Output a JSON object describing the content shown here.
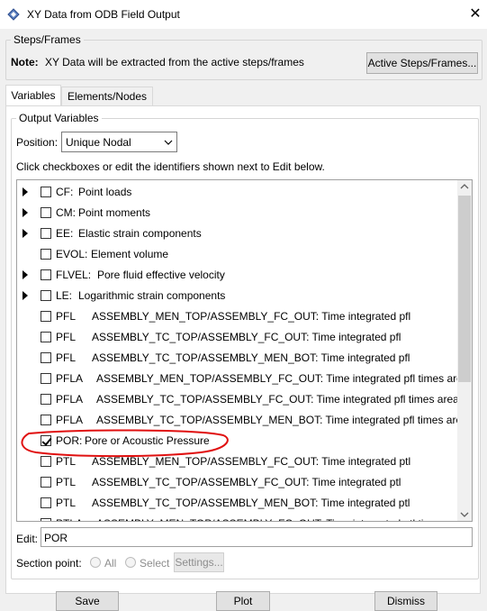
{
  "window": {
    "title": "XY Data from ODB Field Output",
    "close_glyph": "✕"
  },
  "steps": {
    "group_label": "Steps/Frames",
    "note_label": "Note:",
    "note_text": "XY Data will be extracted from the active steps/frames",
    "active_button": "Active Steps/Frames..."
  },
  "tabs": [
    {
      "label": "Variables",
      "active": true
    },
    {
      "label": "Elements/Nodes",
      "active": false
    }
  ],
  "output": {
    "group_label": "Output Variables",
    "position_label": "Position:",
    "position_value": "Unique Nodal",
    "hint": "Click checkboxes or edit the identifiers shown next to Edit below."
  },
  "variables": [
    {
      "code": "CF:",
      "desc": "Point loads",
      "expandable": true,
      "checked": false
    },
    {
      "code": "CM:",
      "desc": "Point moments",
      "expandable": true,
      "checked": false
    },
    {
      "code": "EE:",
      "desc": "Elastic strain components",
      "expandable": true,
      "checked": false
    },
    {
      "code": "EVOL:",
      "desc": "Element volume",
      "expandable": false,
      "checked": false
    },
    {
      "code": "FLVEL:",
      "desc": "Pore fluid effective velocity",
      "expandable": true,
      "checked": false
    },
    {
      "code": "LE:",
      "desc": "Logarithmic strain components",
      "expandable": true,
      "checked": false
    },
    {
      "code": "PFL",
      "desc": "ASSEMBLY_MEN_TOP/ASSEMBLY_FC_OUT: Time integrated pfl",
      "expandable": false,
      "checked": false
    },
    {
      "code": "PFL",
      "desc": "ASSEMBLY_TC_TOP/ASSEMBLY_FC_OUT: Time integrated pfl",
      "expandable": false,
      "checked": false
    },
    {
      "code": "PFL",
      "desc": "ASSEMBLY_TC_TOP/ASSEMBLY_MEN_BOT: Time integrated pfl",
      "expandable": false,
      "checked": false
    },
    {
      "code": "PFLA",
      "desc": "ASSEMBLY_MEN_TOP/ASSEMBLY_FC_OUT: Time integrated pfl times area",
      "expandable": false,
      "checked": false
    },
    {
      "code": "PFLA",
      "desc": "ASSEMBLY_TC_TOP/ASSEMBLY_FC_OUT: Time integrated pfl times area",
      "expandable": false,
      "checked": false
    },
    {
      "code": "PFLA",
      "desc": "ASSEMBLY_TC_TOP/ASSEMBLY_MEN_BOT: Time integrated pfl times area",
      "expandable": false,
      "checked": false
    },
    {
      "code": "POR:",
      "desc": "Pore or Acoustic Pressure",
      "expandable": false,
      "checked": true
    },
    {
      "code": "PTL",
      "desc": "ASSEMBLY_MEN_TOP/ASSEMBLY_FC_OUT: Time integrated ptl",
      "expandable": false,
      "checked": false
    },
    {
      "code": "PTL",
      "desc": "ASSEMBLY_TC_TOP/ASSEMBLY_FC_OUT: Time integrated ptl",
      "expandable": false,
      "checked": false
    },
    {
      "code": "PTL",
      "desc": "ASSEMBLY_TC_TOP/ASSEMBLY_MEN_BOT: Time integrated ptl",
      "expandable": false,
      "checked": false
    },
    {
      "code": "PTLA",
      "desc": "ASSEMBLY_MEN_TOP/ASSEMBLY_FC_OUT: Time integrated ptl times area",
      "expandable": false,
      "checked": false
    }
  ],
  "edit": {
    "label": "Edit:",
    "value": "POR"
  },
  "section_point": {
    "label": "Section point:",
    "all": "All",
    "select": "Select",
    "settings": "Settings..."
  },
  "footer": {
    "save": "Save",
    "plot": "Plot",
    "dismiss": "Dismiss"
  },
  "colors": {
    "annotation": "#e01010",
    "title_bg": "#ffffff",
    "dialog_bg": "#f0f0f0"
  },
  "icons": {
    "title": "abaqus-app-icon",
    "scroll_up": "scroll-up-arrow",
    "scroll_down": "scroll-down-arrow"
  }
}
